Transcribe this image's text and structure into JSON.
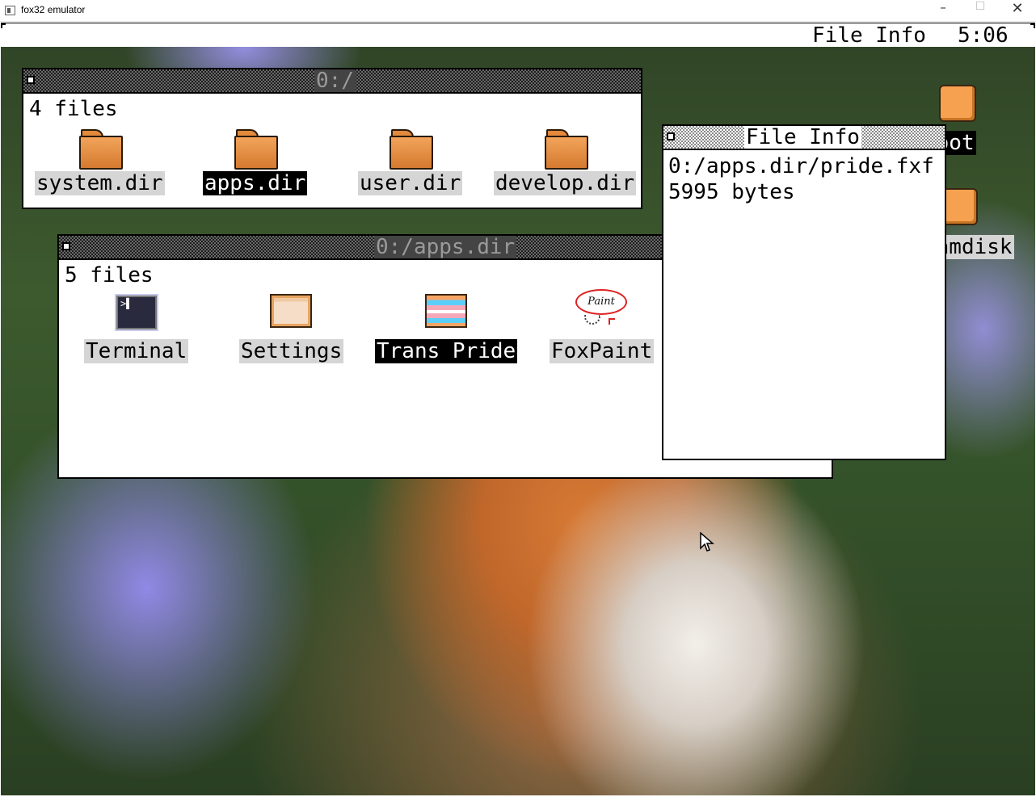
{
  "host": {
    "title": "fox32 emulator",
    "minimize_glyph": "–",
    "maximize_glyph": "☐",
    "close_glyph": "✕"
  },
  "menubar": {
    "title": "File Info",
    "clock": "5:06"
  },
  "desktop": {
    "icons": [
      {
        "label": "boot"
      },
      {
        "label": "ramdisk"
      }
    ]
  },
  "root_window": {
    "title": "0:/",
    "count": "4 files",
    "items": [
      {
        "label": "system.dir",
        "icon": "folder-icon",
        "selected": false
      },
      {
        "label": "apps.dir",
        "icon": "folder-icon",
        "selected": true
      },
      {
        "label": "user.dir",
        "icon": "folder-icon",
        "selected": false
      },
      {
        "label": "develop.dir",
        "icon": "folder-icon",
        "selected": false
      }
    ]
  },
  "apps_window": {
    "title": "0:/apps.dir",
    "count": "5 files",
    "items": [
      {
        "label": "Terminal",
        "icon": "terminal-icon",
        "selected": false
      },
      {
        "label": "Settings",
        "icon": "settings-icon",
        "selected": false
      },
      {
        "label": "Trans Pride",
        "icon": "trans-pride-icon",
        "selected": true
      },
      {
        "label": "FoxPaint",
        "icon": "foxpaint-icon",
        "selected": false
      }
    ]
  },
  "info_window": {
    "title": "File Info",
    "path": "0:/apps.dir/pride.fxf",
    "size": "5995 bytes"
  },
  "icons": {
    "terminal_glyph": ">▌",
    "paint_text": "Paint"
  },
  "colors": {
    "folder_orange": "#e38a3d",
    "selection": "#000000",
    "label_bg": "#d5d5d5"
  }
}
